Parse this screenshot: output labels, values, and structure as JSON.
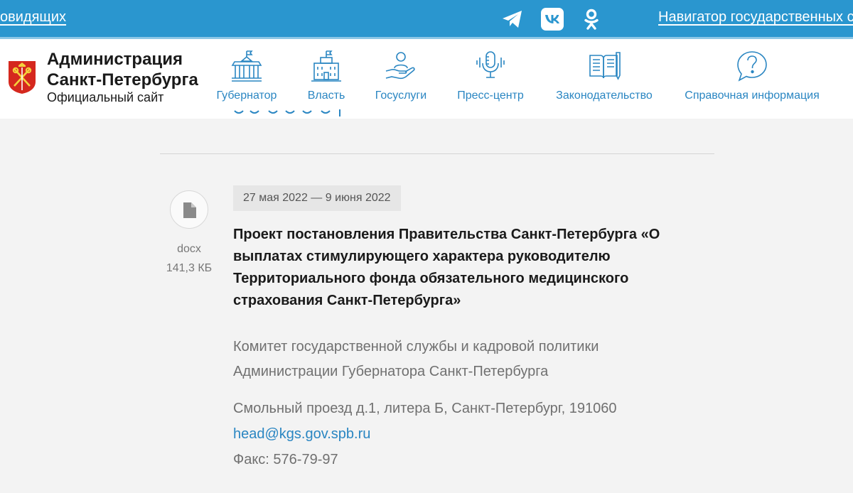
{
  "topbar": {
    "accessibility_link": "овидящих",
    "socials": [
      "telegram-icon",
      "vk-icon",
      "odnoklassniki-icon"
    ],
    "navigator_link": "Навигатор государственных са",
    "bg_color": "#2a96cf"
  },
  "header": {
    "title_line1": "Администрация",
    "title_line2": "Санкт-Петербурга",
    "subtitle": "Официальный сайт",
    "menu": [
      {
        "label": "Губернатор",
        "icon": "governor-palace-icon"
      },
      {
        "label": "Власть",
        "icon": "government-building-icon"
      },
      {
        "label": "Госуслуги",
        "icon": "hand-person-icon"
      },
      {
        "label": "Пресс-центр",
        "icon": "microphone-icon"
      },
      {
        "label": "Законодательство",
        "icon": "book-icon"
      },
      {
        "label": "Справочная информация",
        "icon": "question-bubble-icon"
      }
    ]
  },
  "document": {
    "file_type": "docx",
    "file_size": "141,3 КБ",
    "date_range": "27 мая 2022 — 9 июня 2022",
    "title": "Проект постановления Правительства Санкт-Петербурга «О выплатах стимулирующего характера руководителю Территориального фонда обязательного медицинского страхования Санкт-Петербурга»",
    "organization": "Комитет государственной службы и кадровой политики Администрации Губернатора Санкт-Петербурга",
    "address": "Смольный проезд д.1, литера Б, Санкт-Петербург, 191060",
    "email": "head@kgs.gov.spb.ru",
    "fax": "Факс: 576-79-97"
  },
  "colors": {
    "accent": "#2a86c2",
    "muted_text": "#707070",
    "emblem_red": "#d5281e"
  }
}
